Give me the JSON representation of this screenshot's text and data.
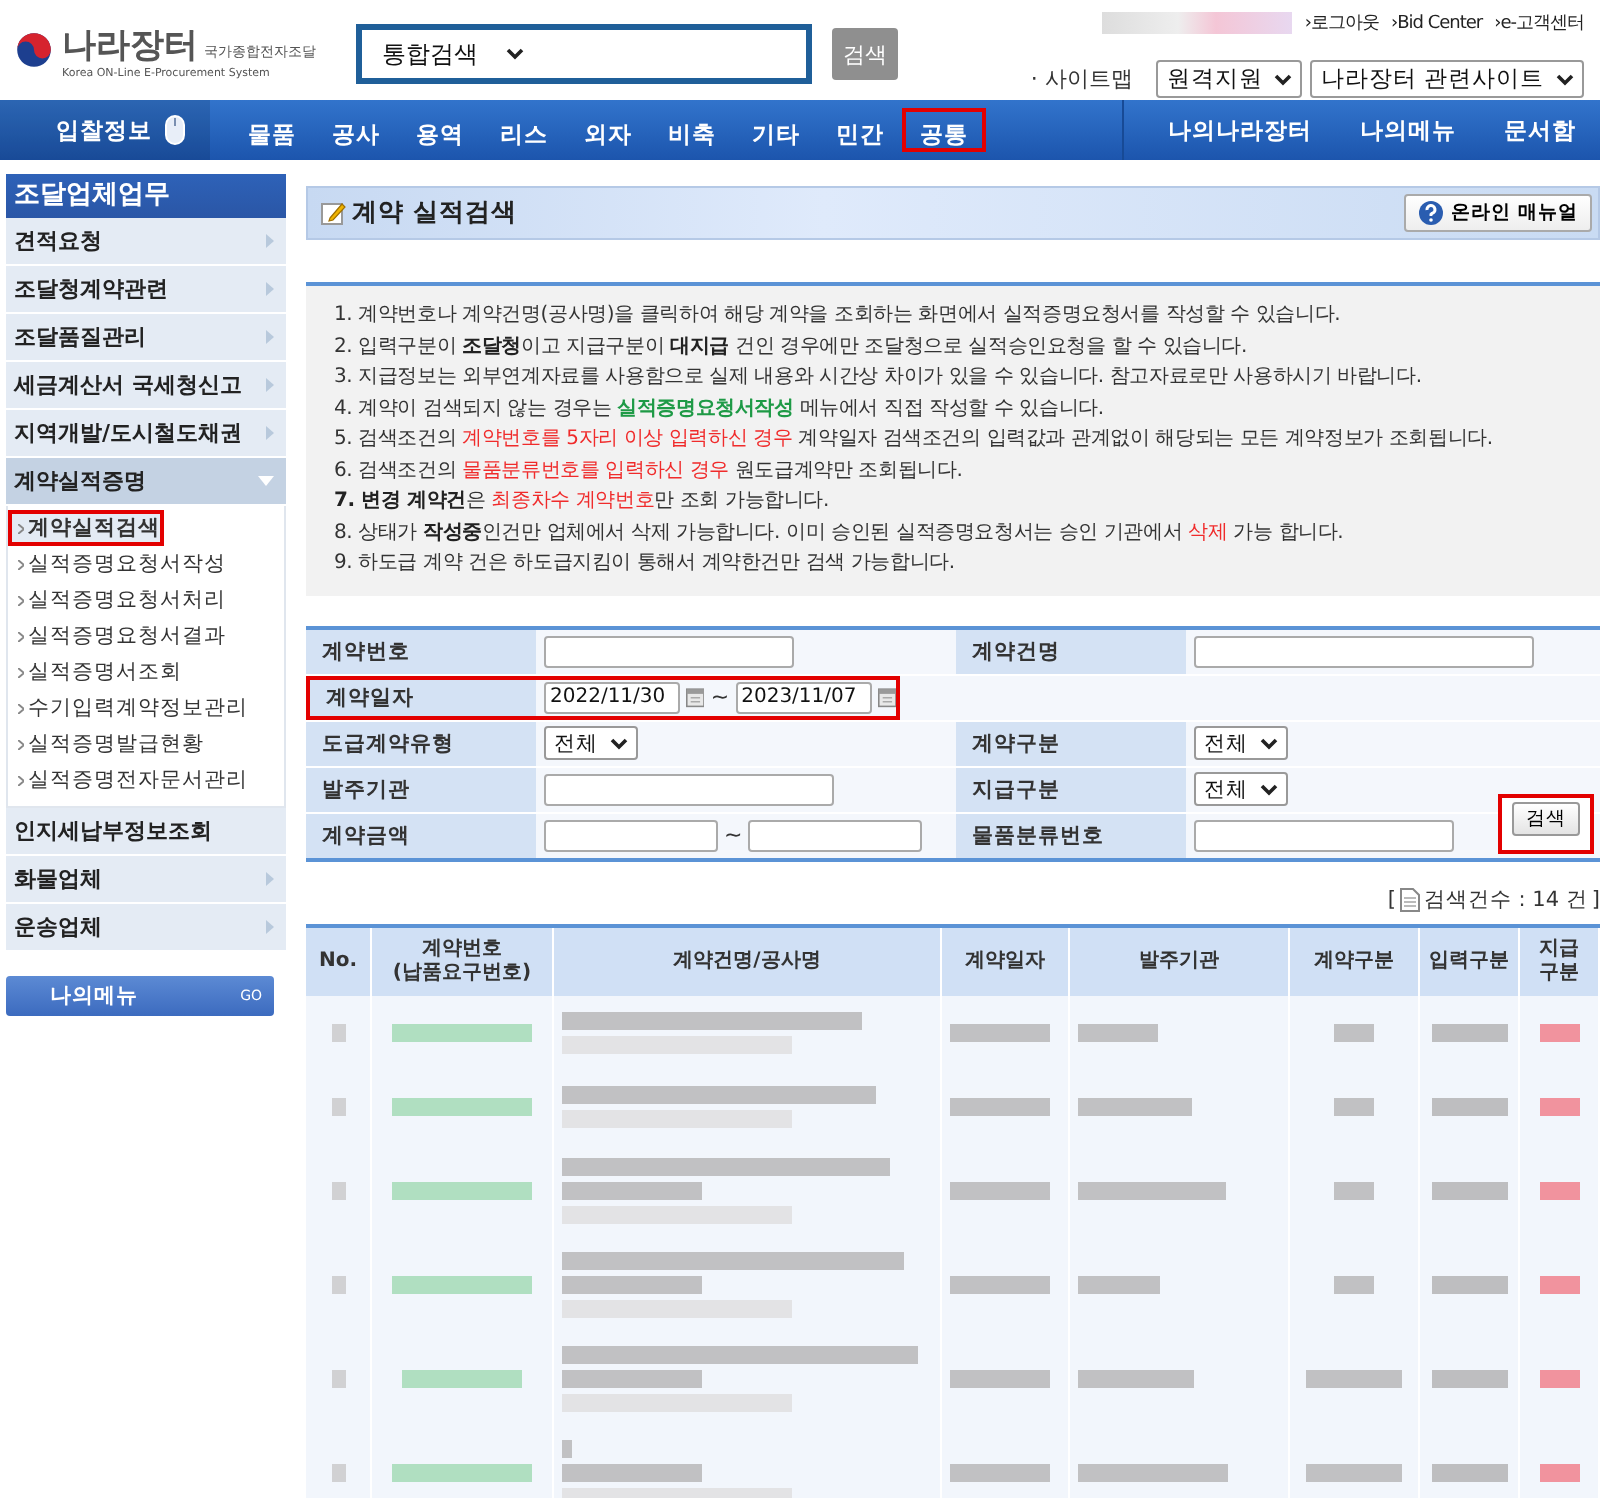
{
  "header": {
    "logo": {
      "name": "나라장터",
      "subtitle": "국가종합전자조달",
      "english": "Korea ON-Line E-Procurement System"
    },
    "search": {
      "scope": "통합검색",
      "button": "검색"
    },
    "user_links": [
      "›로그아웃",
      "›Bid Center",
      "›e-고객센터"
    ],
    "sitemap": "· 사이트맵",
    "selects": [
      "원격지원",
      "나라장터 관련사이트"
    ]
  },
  "nav": {
    "lead": "입찰정보",
    "items": [
      {
        "label": "물품",
        "highlighted": false
      },
      {
        "label": "공사",
        "highlighted": false
      },
      {
        "label": "용역",
        "highlighted": false
      },
      {
        "label": "리스",
        "highlighted": false
      },
      {
        "label": "외자",
        "highlighted": false
      },
      {
        "label": "비축",
        "highlighted": false
      },
      {
        "label": "기타",
        "highlighted": false
      },
      {
        "label": "민간",
        "highlighted": false
      },
      {
        "label": "공통",
        "highlighted": true
      }
    ],
    "right_items": [
      "나의나라장터",
      "나의메뉴",
      "문서함"
    ]
  },
  "sidebar": {
    "title": "조달업체업무",
    "items": [
      {
        "label": "견적요청",
        "has_submenu": true,
        "expanded": false
      },
      {
        "label": "조달청계약관련",
        "has_submenu": true,
        "expanded": false
      },
      {
        "label": "조달품질관리",
        "has_submenu": true,
        "expanded": false
      },
      {
        "label": "세금계산서 국세청신고",
        "has_submenu": true,
        "expanded": false
      },
      {
        "label": "지역개발/도시철도채권",
        "has_submenu": true,
        "expanded": false
      },
      {
        "label": "계약실적증명",
        "has_submenu": true,
        "expanded": true,
        "children": [
          {
            "label": "계약실적검색",
            "selected": true,
            "highlighted": true
          },
          {
            "label": "실적증명요청서작성",
            "selected": false,
            "highlighted": false
          },
          {
            "label": "실적증명요청서처리",
            "selected": false,
            "highlighted": false
          },
          {
            "label": "실적증명요청서결과",
            "selected": false,
            "highlighted": false
          },
          {
            "label": "실적증명서조회",
            "selected": false,
            "highlighted": false
          },
          {
            "label": "수기입력계약정보관리",
            "selected": false,
            "highlighted": false
          },
          {
            "label": "실적증명발급현황",
            "selected": false,
            "highlighted": false
          },
          {
            "label": "실적증명전자문서관리",
            "selected": false,
            "highlighted": false
          }
        ]
      },
      {
        "label": "인지세납부정보조회",
        "has_submenu": false,
        "expanded": false
      },
      {
        "label": "화물업체",
        "has_submenu": true,
        "expanded": false
      },
      {
        "label": "운송업체",
        "has_submenu": true,
        "expanded": false
      }
    ],
    "my_menu": {
      "label": "나의메뉴",
      "go": "GO"
    }
  },
  "page": {
    "title": "계약 실적검색",
    "manual_button": "온라인 매뉴얼"
  },
  "notices": [
    [
      {
        "text": "1. 계약번호나 계약건명(공사명)을 클릭하여 해당 계약을 조회하는 화면에서 실적증명요청서를 작성할 수 있습니다.",
        "kind": "plain"
      }
    ],
    [
      {
        "text": "2. 입력구분이 ",
        "kind": "plain"
      },
      {
        "text": "조달청",
        "kind": "bold"
      },
      {
        "text": "이고 지급구분이 ",
        "kind": "plain"
      },
      {
        "text": "대지급",
        "kind": "bold"
      },
      {
        "text": " 건인 경우에만 조달청으로 실적승인요청을 할 수 있습니다.",
        "kind": "plain"
      }
    ],
    [
      {
        "text": "3. 지급정보는 외부연계자료를 사용함으로 실제 내용와 시간상 차이가 있을 수 있습니다. 참고자료로만 사용하시기 바랍니다.",
        "kind": "plain"
      }
    ],
    [
      {
        "text": "4. 계약이 검색되지 않는 경우는 ",
        "kind": "plain"
      },
      {
        "text": "실적증명요청서작성",
        "kind": "green"
      },
      {
        "text": " 메뉴에서 직접 작성할 수 있습니다.",
        "kind": "plain"
      }
    ],
    [
      {
        "text": "5. 검색조건의 ",
        "kind": "plain"
      },
      {
        "text": "계약번호를 5자리 이상 입력하신 경우",
        "kind": "red"
      },
      {
        "text": " 계약일자 검색조건의 입력값과 관계없이 해당되는 모든 계약정보가 조회됩니다.",
        "kind": "plain"
      }
    ],
    [
      {
        "text": "6. 검색조건의 ",
        "kind": "plain"
      },
      {
        "text": "물품분류번호를 입력하신 경우",
        "kind": "red"
      },
      {
        "text": " 원도급계약만 조회됩니다.",
        "kind": "plain"
      }
    ],
    [
      {
        "text": "7. 변경 계약건",
        "kind": "bold"
      },
      {
        "text": "은 ",
        "kind": "plain"
      },
      {
        "text": "최종차수 계약번호",
        "kind": "red"
      },
      {
        "text": "만 조회 가능합니다.",
        "kind": "plain"
      }
    ],
    [
      {
        "text": "8. 상태가 ",
        "kind": "plain"
      },
      {
        "text": "작성중",
        "kind": "bold"
      },
      {
        "text": "인건만 업체에서 삭제 가능합니다. 이미 승인된 실적증명요청서는 승인 기관에서 ",
        "kind": "plain"
      },
      {
        "text": "삭제",
        "kind": "red"
      },
      {
        "text": " 가능 합니다.",
        "kind": "plain"
      }
    ],
    [
      {
        "text": "9. 하도급 계약 건은 하도급지킴이 통해서 계약한건만 검색 가능합니다.",
        "kind": "plain"
      }
    ]
  ],
  "form": {
    "rows": [
      [
        {
          "label": "계약번호",
          "kind": "text",
          "highlighted": false
        },
        {
          "label": "계약건명",
          "kind": "text",
          "highlighted": false
        }
      ],
      [
        {
          "label": "계약일자",
          "kind": "date-range",
          "from": "2022/11/30",
          "to": "2023/11/07",
          "separator": "~",
          "highlighted": true
        }
      ],
      [
        {
          "label": "도급계약유형",
          "kind": "select",
          "value": "전체",
          "highlighted": false
        },
        {
          "label": "계약구분",
          "kind": "select",
          "value": "전체",
          "highlighted": false
        }
      ],
      [
        {
          "label": "발주기관",
          "kind": "text",
          "highlighted": false
        },
        {
          "label": "지급구분",
          "kind": "select",
          "value": "전체",
          "highlighted": false
        }
      ],
      [
        {
          "label": "계약금액",
          "kind": "range",
          "separator": "~",
          "highlighted": false
        },
        {
          "label": "물품분류번호",
          "kind": "text",
          "highlighted": false
        }
      ]
    ],
    "search_button": {
      "label": "검색",
      "highlighted": true
    }
  },
  "result_count": {
    "open": "[",
    "text": "검색건수 : 14 건",
    "close": "]"
  },
  "table": {
    "columns": [
      "No.",
      "계약번호\n(납품요구번호)",
      "계약건명/공사명",
      "계약일자",
      "발주기관",
      "계약구분",
      "입력구분",
      "지급\n구분"
    ],
    "rows": [
      {
        "kind": "two-line"
      },
      {
        "kind": "two-line"
      },
      {
        "kind": "three-line"
      },
      {
        "kind": "three-line"
      },
      {
        "kind": "three-line"
      },
      {
        "kind": "three-line"
      }
    ]
  }
}
